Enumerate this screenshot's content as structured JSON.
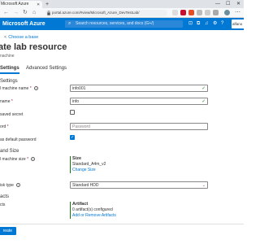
{
  "browser": {
    "tab_title": "Microsoft Azure",
    "url": "portal.azure.com/#view/Microsoft_Azure_DevTestLab/",
    "colors": {
      "toolbar": "#f7f8f9",
      "tabbar": "#dfe3e8"
    }
  },
  "portal": {
    "brand": "Microsoft Azure",
    "search_placeholder": "Search resources, services, and docs (G+/)",
    "account_label": "alfano",
    "accent": "#0078d4"
  },
  "breadcrumb": {
    "label": "Choose a base"
  },
  "page": {
    "title": "ate lab resource",
    "more": "...",
    "subtitle": "nachine"
  },
  "tabs": [
    {
      "label": "Settings",
      "active": true
    },
    {
      "label": "Advanced Settings",
      "active": false
    }
  ],
  "form": {
    "section_settings": "Settings",
    "vm_name_label": "l machine name",
    "vm_name_value": "info001",
    "user_name_label": "name",
    "user_name_value": "info",
    "saved_secret_label": "saved secret",
    "password_label": "ord",
    "password_placeholder": "Password",
    "default_password_label": "as default password",
    "section_size": "and Size",
    "vm_size_label": "l machine size",
    "size_card": {
      "title": "Size",
      "value": "Standard_A4m_v2",
      "link": "Change Size"
    },
    "disk_type_label": "isk type",
    "disk_type_value": "Standard HDD",
    "section_artifacts": "acts",
    "artifacts_label": "cts",
    "artifact_card": {
      "title": "Artifact",
      "value": "0 artifact(s) configured",
      "link": "Add or Remove Artifacts"
    },
    "valid_mark": "✓"
  },
  "footer": {
    "create_label": "reate"
  }
}
